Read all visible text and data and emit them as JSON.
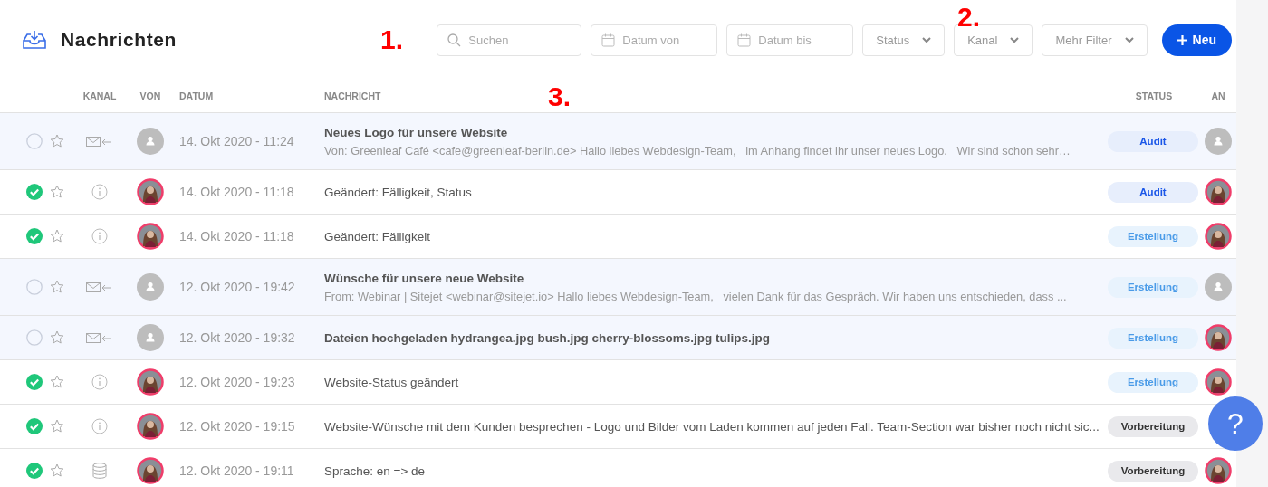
{
  "header": {
    "title": "Nachrichten",
    "search": {
      "placeholder": "Suchen"
    },
    "date_from": {
      "placeholder": "Datum von"
    },
    "date_to": {
      "placeholder": "Datum bis"
    },
    "filters": [
      "Status",
      "Kanal",
      "Mehr Filter"
    ],
    "new_button": "Neu"
  },
  "columns": {
    "channel": "KANAL",
    "from": "VON",
    "date": "DATUM",
    "message": "NACHRICHT",
    "status": "STATUS",
    "to": "AN"
  },
  "rows": [
    {
      "unread": true,
      "checked": false,
      "starred": false,
      "channel": {
        "kind": "mail"
      },
      "sender": {
        "kind": "placeholder"
      },
      "date": "14. Okt 2020 - 11:24",
      "subject": "Neues Logo für unsere Website",
      "preview": "Von: Greenleaf Café <cafe@greenleaf-berlin.de> Hallo liebes Webdesign-Team,   im Anhang findet ihr unser neues Logo.   Wir sind schon sehr…",
      "status": {
        "label": "Audit",
        "kind": "audit"
      },
      "recipient": {
        "kind": "placeholder"
      }
    },
    {
      "unread": false,
      "checked": true,
      "starred": false,
      "channel": {
        "kind": "info"
      },
      "sender": {
        "kind": "photo"
      },
      "date": "14. Okt 2020 - 11:18",
      "subject": "Geändert: Fälligkeit, Status",
      "status": {
        "label": "Audit",
        "kind": "audit"
      },
      "recipient": {
        "kind": "photo"
      }
    },
    {
      "unread": false,
      "checked": true,
      "starred": false,
      "channel": {
        "kind": "info"
      },
      "sender": {
        "kind": "photo"
      },
      "date": "14. Okt 2020 - 11:18",
      "subject": "Geändert: Fälligkeit",
      "status": {
        "label": "Erstellung",
        "kind": "creation"
      },
      "recipient": {
        "kind": "photo"
      }
    },
    {
      "unread": true,
      "checked": false,
      "starred": false,
      "channel": {
        "kind": "mail"
      },
      "sender": {
        "kind": "placeholder"
      },
      "date": "12. Okt 2020 - 19:42",
      "subject": "Wünsche für unsere neue Website",
      "preview": "From: Webinar | Sitejet <webinar@sitejet.io> Hallo liebes Webdesign-Team,   vielen Dank für das Gespräch. Wir haben uns entschieden, dass ...",
      "status": {
        "label": "Erstellung",
        "kind": "creation"
      },
      "recipient": {
        "kind": "placeholder"
      }
    },
    {
      "unread": true,
      "checked": false,
      "starred": false,
      "channel": {
        "kind": "mail"
      },
      "sender": {
        "kind": "placeholder"
      },
      "date": "12. Okt 2020 - 19:32",
      "subject": "Dateien hochgeladen hydrangea.jpg bush.jpg cherry-blossoms.jpg tulips.jpg",
      "status": {
        "label": "Erstellung",
        "kind": "creation"
      },
      "recipient": {
        "kind": "photo"
      }
    },
    {
      "unread": false,
      "checked": true,
      "starred": false,
      "channel": {
        "kind": "info"
      },
      "sender": {
        "kind": "photo"
      },
      "date": "12. Okt 2020 - 19:23",
      "subject": "Website-Status geändert",
      "status": {
        "label": "Erstellung",
        "kind": "creation"
      },
      "recipient": {
        "kind": "photo"
      }
    },
    {
      "unread": false,
      "checked": true,
      "starred": false,
      "channel": {
        "kind": "info"
      },
      "sender": {
        "kind": "photo"
      },
      "date": "12. Okt 2020 - 19:15",
      "subject": "Website-Wünsche mit dem Kunden besprechen - Logo und Bilder vom Laden kommen auf jeden Fall. Team-Section war bisher noch nicht sic...",
      "status": {
        "label": "Vorbereitung",
        "kind": "preparation"
      }
    },
    {
      "unread": false,
      "checked": true,
      "starred": false,
      "channel": {
        "kind": "database"
      },
      "sender": {
        "kind": "photo"
      },
      "date": "12. Okt 2020 - 19:11",
      "subject": "Sprache: en => de",
      "status": {
        "label": "Vorbereitung",
        "kind": "preparation"
      },
      "recipient": {
        "kind": "photo"
      }
    }
  ],
  "help_button": "?",
  "annotations": [
    {
      "label": "1.",
      "kind": "search"
    },
    {
      "label": "2.",
      "kind": "channel"
    },
    {
      "label": "3.",
      "kind": "message"
    }
  ]
}
